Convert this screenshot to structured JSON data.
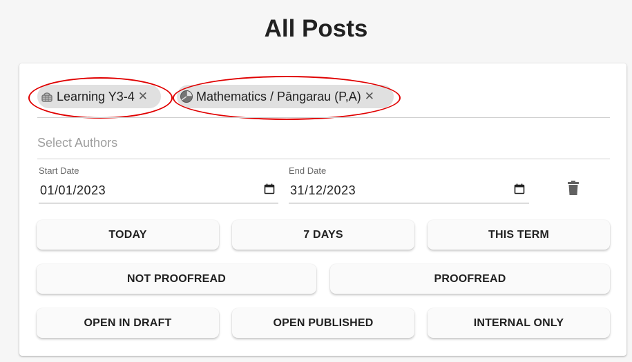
{
  "page": {
    "title": "All Posts"
  },
  "filters": {
    "chips": [
      {
        "label": "Learning Y3-4",
        "icon": "basket-icon",
        "remove_icon": "close-icon"
      },
      {
        "label": "Mathematics / Pāngarau (P,A)",
        "icon": "pie-chart-icon",
        "remove_icon": "close-icon"
      }
    ],
    "highlight_color": "#e00000",
    "authors": {
      "placeholder": "Select Authors",
      "value": ""
    },
    "start_date": {
      "label": "Start Date",
      "value": "01/01/2023",
      "icon": "calendar-icon"
    },
    "end_date": {
      "label": "End Date",
      "value": "31/12/2023",
      "icon": "calendar-icon"
    },
    "clear_icon": "trash-icon"
  },
  "quick_buttons": {
    "row1": [
      "TODAY",
      "7 DAYS",
      "THIS TERM"
    ],
    "row2": [
      "NOT PROOFREAD",
      "PROOFREAD"
    ],
    "row3": [
      "OPEN IN DRAFT",
      "OPEN PUBLISHED",
      "INTERNAL ONLY"
    ]
  }
}
